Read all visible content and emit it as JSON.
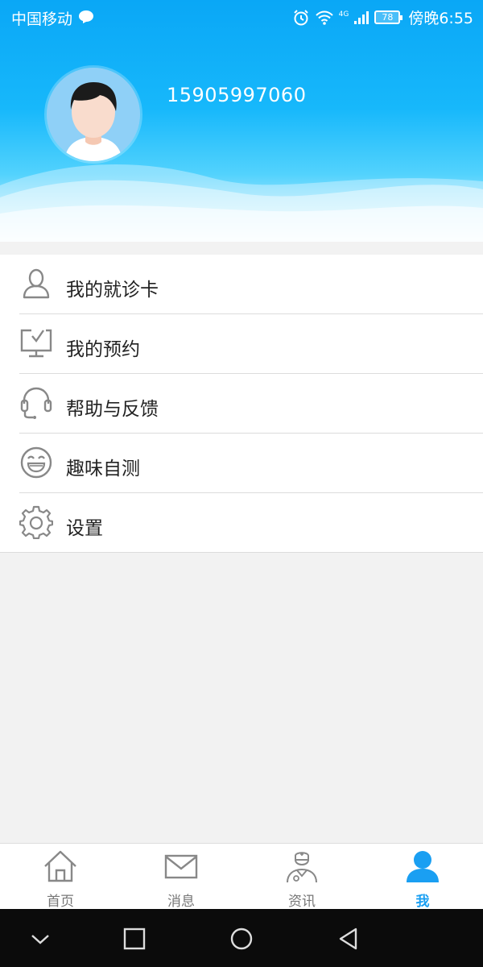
{
  "status_bar": {
    "carrier": "中国移动",
    "network": "4G",
    "battery": "78",
    "time": "傍晚6:55"
  },
  "profile": {
    "phone": "15905997060"
  },
  "menu": {
    "items": [
      {
        "label": "我的就诊卡",
        "icon": "person-card-icon"
      },
      {
        "label": "我的预约",
        "icon": "appointment-screen-icon"
      },
      {
        "label": "帮助与反馈",
        "icon": "headset-icon"
      },
      {
        "label": "趣味自测",
        "icon": "smiley-icon"
      },
      {
        "label": "设置",
        "icon": "gear-icon"
      }
    ]
  },
  "tabbar": {
    "tabs": [
      {
        "label": "首页",
        "icon": "home-icon",
        "active": false
      },
      {
        "label": "消息",
        "icon": "mail-icon",
        "active": false
      },
      {
        "label": "资讯",
        "icon": "doctor-icon",
        "active": false
      },
      {
        "label": "我",
        "icon": "user-icon",
        "active": true
      }
    ],
    "active_color": "#1a9ff2",
    "inactive_color": "#777777"
  },
  "colors": {
    "header_top": "#0aa7f6",
    "header_bottom": "#e8f8fe",
    "background": "#f2f2f2",
    "icon_gray": "#888888"
  }
}
